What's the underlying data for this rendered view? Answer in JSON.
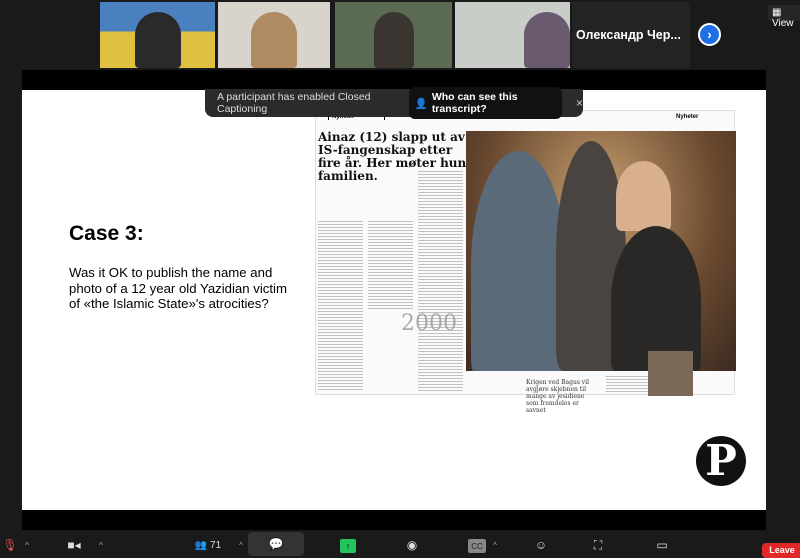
{
  "participants": {
    "named_tile": "Олександр  Чер...",
    "view_label": "View",
    "next_icon": "chevron-right"
  },
  "notification": {
    "message": "A participant has enabled Closed Captioning",
    "link": "Who can see this transcript?",
    "close": "×"
  },
  "slide": {
    "title": "Case 3:",
    "body": "Was it OK to publish the name and photo of a 12 year old Yazidian victim of «the Islamic State»'s atrocities?",
    "newspaper": {
      "section": "Nyheter",
      "headline": "Ainaz (12) slapp ut av IS-fangenskap etter fire år. Her møter hun familien.",
      "year": "2000",
      "pull_quote": "Krigen ved Bagus vil avgjøre skjebnen til mange av jesidiene som fremdeles er savnet"
    },
    "logo_letter": "P"
  },
  "toolbar": {
    "participants_count": "71",
    "cc_label": "CC",
    "leave_label": "Leave"
  },
  "colors": {
    "accent": "#1f6fe5",
    "leave": "#e02828",
    "share": "#22c55e"
  }
}
